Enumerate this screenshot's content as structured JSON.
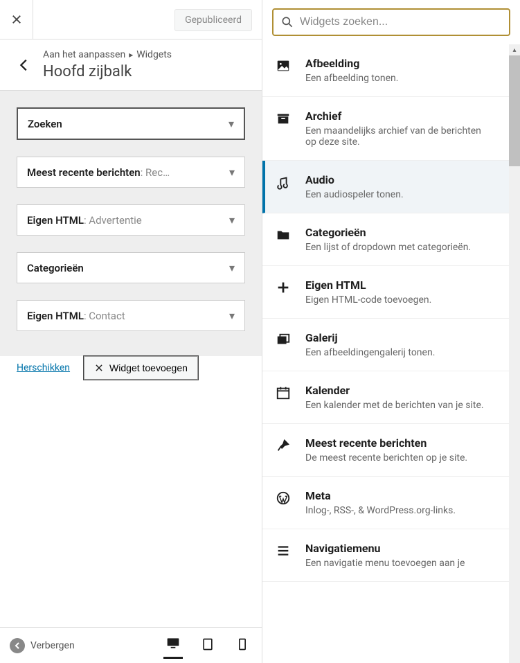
{
  "topbar": {
    "publish_label": "Gepubliceerd"
  },
  "header": {
    "breadcrumb_customizing": "Aan het aanpassen",
    "breadcrumb_section": "Widgets",
    "title": "Hoofd zijbalk"
  },
  "sidebar_widgets": [
    {
      "title": "Zoeken",
      "subtitle": "",
      "active": true
    },
    {
      "title": "Meest recente berichten",
      "subtitle": "Rec…",
      "active": false
    },
    {
      "title": "Eigen HTML",
      "subtitle": "Advertentie",
      "active": false
    },
    {
      "title": "Categorieën",
      "subtitle": "",
      "active": false
    },
    {
      "title": "Eigen HTML",
      "subtitle": "Contact",
      "active": false
    }
  ],
  "actions": {
    "reorder": "Herschikken",
    "add_widget": "Widget toevoegen"
  },
  "footer": {
    "hide": "Verbergen"
  },
  "search": {
    "placeholder": "Widgets zoeken..."
  },
  "catalog": [
    {
      "icon": "image",
      "name": "Afbeelding",
      "desc": "Een afbeelding tonen.",
      "selected": false
    },
    {
      "icon": "archive",
      "name": "Archief",
      "desc": "Een maandelijks archief van de berichten op deze site.",
      "selected": false
    },
    {
      "icon": "audio",
      "name": "Audio",
      "desc": "Een audiospeler tonen.",
      "selected": true
    },
    {
      "icon": "folder",
      "name": "Categorieën",
      "desc": "Een lijst of dropdown met categorieën.",
      "selected": false
    },
    {
      "icon": "plus",
      "name": "Eigen HTML",
      "desc": "Eigen HTML-code toevoegen.",
      "selected": false
    },
    {
      "icon": "gallery",
      "name": "Galerij",
      "desc": "Een afbeeldingengalerij tonen.",
      "selected": false
    },
    {
      "icon": "calendar",
      "name": "Kalender",
      "desc": "Een kalender met de berichten van je site.",
      "selected": false
    },
    {
      "icon": "pin",
      "name": "Meest recente berichten",
      "desc": "De meest recente berichten op je site.",
      "selected": false
    },
    {
      "icon": "wp",
      "name": "Meta",
      "desc": "Inlog-, RSS-, & WordPress.org-links.",
      "selected": false
    },
    {
      "icon": "menu",
      "name": "Navigatiemenu",
      "desc": "Een navigatie menu toevoegen aan je",
      "selected": false
    }
  ]
}
